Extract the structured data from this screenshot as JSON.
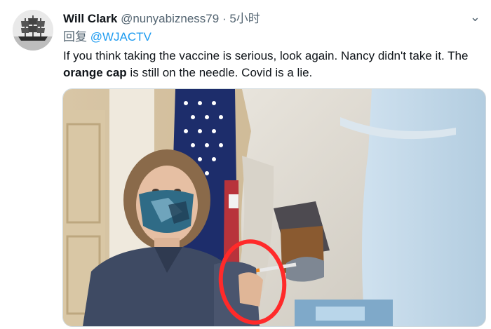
{
  "author": {
    "name": "Will Clark",
    "handle": "@nunyabizness79",
    "separator": "·",
    "time": "5小时",
    "avatar_icon": "sailing-ship-avatar"
  },
  "more_icon": "more-options-icon",
  "more_glyph": "⌄",
  "reply": {
    "prefix": "回复",
    "mention": "@WJACTV"
  },
  "tweet_text": {
    "part1": "If you think taking the vaccine is serious, look again. Nancy didn't take it. The ",
    "bold": "orange cap",
    "part2": " is still on the needle. Covid is a lie."
  },
  "media": {
    "description_icon": "vaccination-photo",
    "highlight_color": "#ff2a2a"
  },
  "colors": {
    "text": "#0f1419",
    "secondary": "#536471",
    "link": "#1d9bf0"
  }
}
